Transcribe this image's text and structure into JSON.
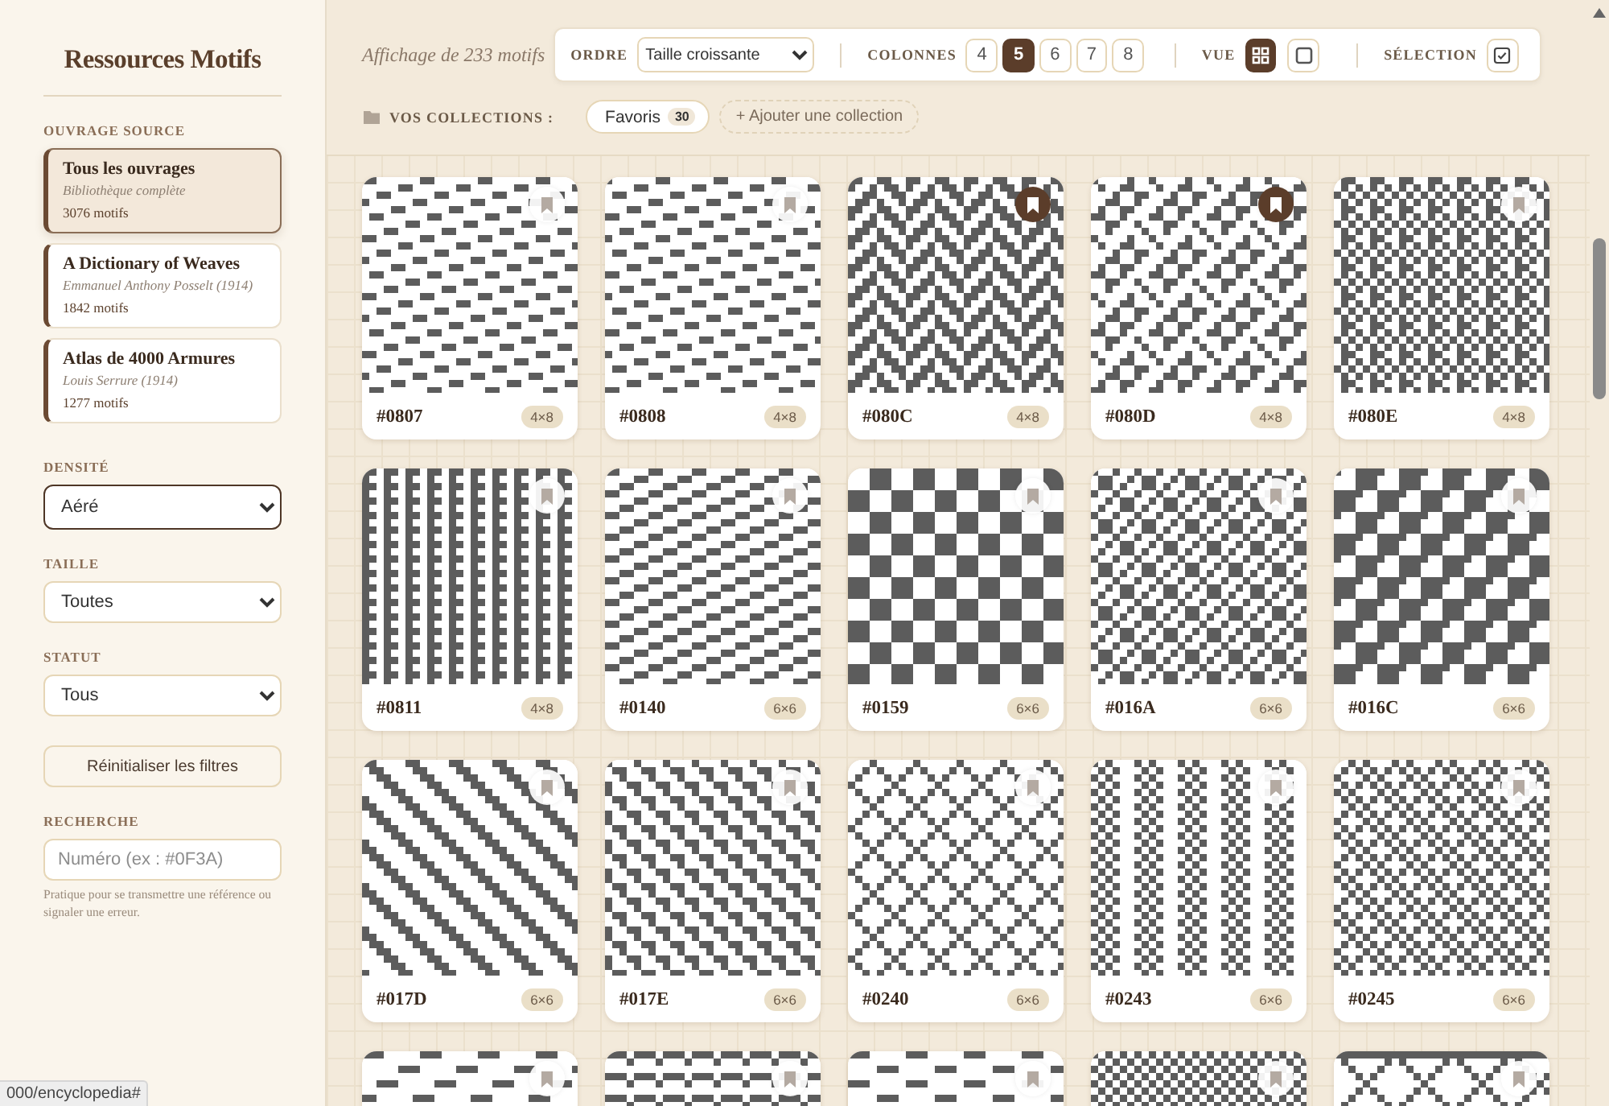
{
  "sidebar": {
    "title": "Ressources Motifs",
    "source_label": "OUVRAGE SOURCE",
    "sources": [
      {
        "title": "Tous les ouvrages",
        "subtitle": "Bibliothèque complète",
        "count": "3076 motifs",
        "selected": true
      },
      {
        "title": "A Dictionary of Weaves",
        "subtitle": "Emmanuel Anthony Posselt (1914)",
        "count": "1842 motifs",
        "selected": false
      },
      {
        "title": "Atlas de 4000 Armures",
        "subtitle": "Louis Serrure (1914)",
        "count": "1277 motifs",
        "selected": false
      }
    ],
    "filters": [
      {
        "label": "DENSITÉ",
        "value": "Aéré",
        "focused": true
      },
      {
        "label": "TAILLE",
        "value": "Toutes",
        "focused": false
      },
      {
        "label": "STATUT",
        "value": "Tous",
        "focused": false
      }
    ],
    "reset_button": "Réinitialiser les filtres",
    "search": {
      "label": "RECHERCHE",
      "placeholder": "Numéro (ex : #0F3A)",
      "help": "Pratique pour se transmettre une référence ou signaler une erreur."
    }
  },
  "toolbar": {
    "summary": "Affichage de 233 motifs",
    "order": {
      "label": "ORDRE",
      "value": "Taille croissante"
    },
    "columns": {
      "label": "COLONNES",
      "options": [
        {
          "label": "4",
          "selected": false
        },
        {
          "label": "5",
          "selected": true
        },
        {
          "label": "6",
          "selected": false
        },
        {
          "label": "7",
          "selected": false
        },
        {
          "label": "8",
          "selected": false
        }
      ]
    },
    "view": {
      "label": "VUE",
      "options": [
        {
          "kind": "grid",
          "selected": true
        },
        {
          "kind": "single",
          "selected": false
        }
      ]
    },
    "selection": {
      "label": "SÉLECTION"
    }
  },
  "collections": {
    "label": "VOS COLLECTIONS :",
    "items": [
      {
        "name": "Favoris",
        "count": "30"
      }
    ],
    "add_button": "+ Ajouter une collection"
  },
  "cards": [
    {
      "id": "#0807",
      "size": "4×8",
      "bookmarked": false
    },
    {
      "id": "#0808",
      "size": "4×8",
      "bookmarked": false
    },
    {
      "id": "#080C",
      "size": "4×8",
      "bookmarked": true
    },
    {
      "id": "#080D",
      "size": "4×8",
      "bookmarked": true
    },
    {
      "id": "#080E",
      "size": "4×8",
      "bookmarked": false
    },
    {
      "id": "#0811",
      "size": "4×8",
      "bookmarked": false
    },
    {
      "id": "#0140",
      "size": "6×6",
      "bookmarked": false
    },
    {
      "id": "#0159",
      "size": "6×6",
      "bookmarked": false
    },
    {
      "id": "#016A",
      "size": "6×6",
      "bookmarked": false
    },
    {
      "id": "#016C",
      "size": "6×6",
      "bookmarked": false
    },
    {
      "id": "#017D",
      "size": "6×6",
      "bookmarked": false
    },
    {
      "id": "#017E",
      "size": "6×6",
      "bookmarked": false
    },
    {
      "id": "#0240",
      "size": "6×6",
      "bookmarked": false
    },
    {
      "id": "#0243",
      "size": "6×6",
      "bookmarked": false
    },
    {
      "id": "#0245",
      "size": "6×6",
      "bookmarked": false
    },
    {
      "bookmarked": false
    },
    {
      "bookmarked": false
    },
    {
      "bookmarked": false
    },
    {
      "bookmarked": false
    },
    {
      "bookmarked": false
    }
  ],
  "status_url": "000/encyclopedia#"
}
